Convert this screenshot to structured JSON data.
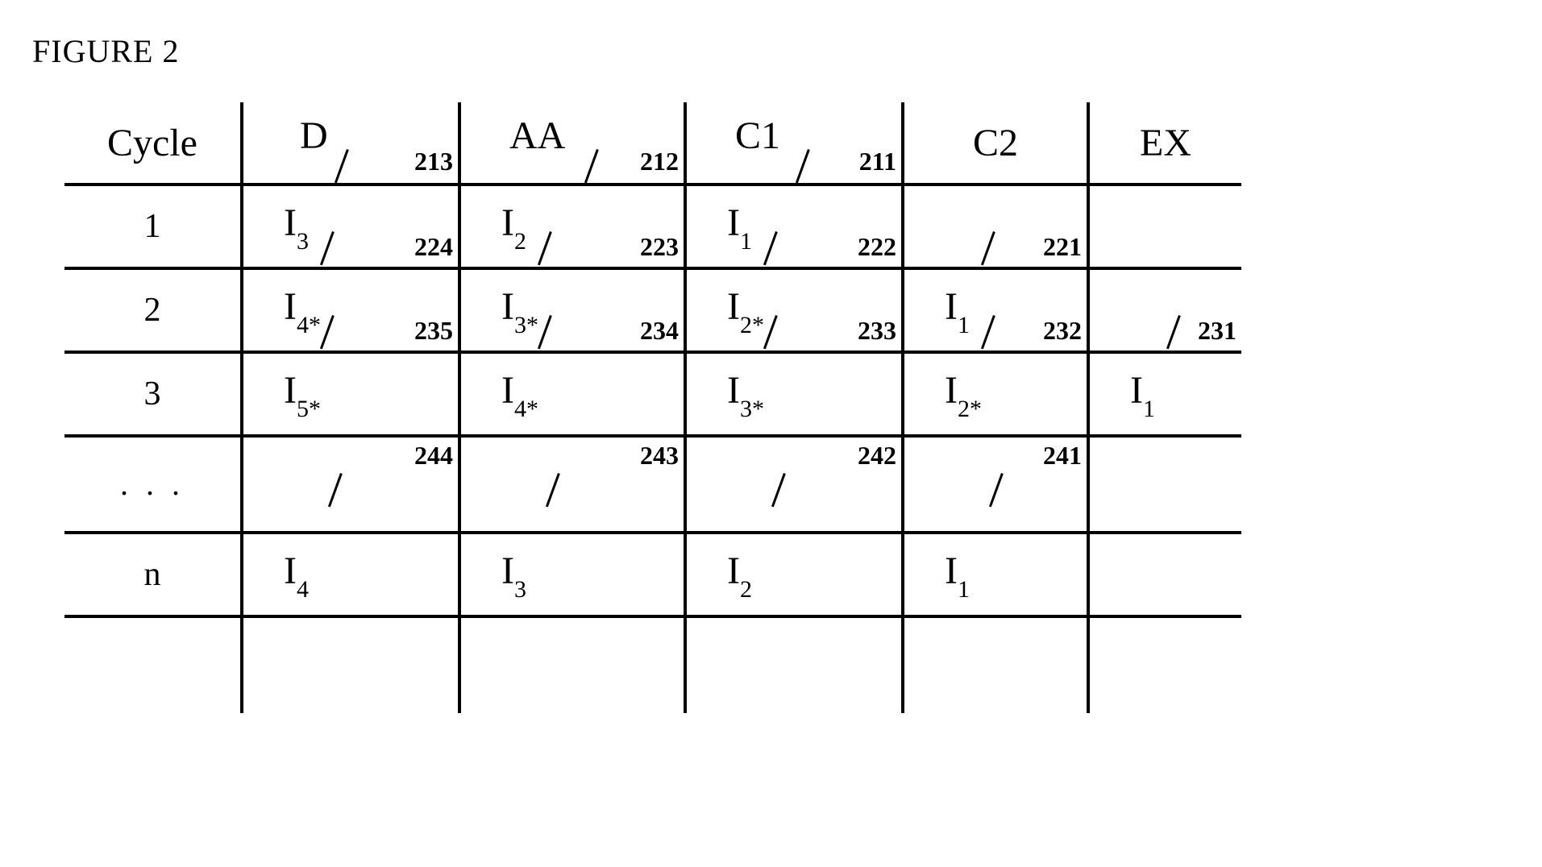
{
  "title": "FIGURE 2",
  "headers": {
    "cycle": "Cycle",
    "d": {
      "label": "D",
      "ref": "213",
      "has_slash": true
    },
    "aa": {
      "label": "AA",
      "ref": "212",
      "has_slash": true
    },
    "c1": {
      "label": "C1",
      "ref": "211",
      "has_slash": true
    },
    "c2": {
      "label": "C2"
    },
    "ex": {
      "label": "EX"
    }
  },
  "rows": [
    {
      "cycle": "1",
      "d": {
        "base": "I",
        "sub": "3",
        "ref": "224",
        "slash": true
      },
      "aa": {
        "base": "I",
        "sub": "2",
        "ref": "223",
        "slash": true
      },
      "c1": {
        "base": "I",
        "sub": "1",
        "ref": "222",
        "slash": true
      },
      "c2": {
        "base": "",
        "sub": "",
        "ref": "221",
        "slash": true
      },
      "ex": {
        "base": "",
        "sub": ""
      }
    },
    {
      "cycle": "2",
      "d": {
        "base": "I",
        "sub": "4*",
        "ref": "235",
        "slash": true
      },
      "aa": {
        "base": "I",
        "sub": "3*",
        "ref": "234",
        "slash": true
      },
      "c1": {
        "base": "I",
        "sub": "2*",
        "ref": "233",
        "slash": true
      },
      "c2": {
        "base": "I",
        "sub": "1",
        "ref": "232",
        "slash": true
      },
      "ex": {
        "base": "",
        "sub": "",
        "ref": "231",
        "slash": true
      }
    },
    {
      "cycle": "3",
      "d": {
        "base": "I",
        "sub": "5*"
      },
      "aa": {
        "base": "I",
        "sub": "4*"
      },
      "c1": {
        "base": "I",
        "sub": "3*"
      },
      "c2": {
        "base": "I",
        "sub": "2*"
      },
      "ex": {
        "base": "I",
        "sub": "1"
      }
    },
    {
      "cycle": ". . .",
      "d": {
        "base": "",
        "sub": "",
        "ref": "244",
        "slash": true,
        "ref_pos": "tr"
      },
      "aa": {
        "base": "",
        "sub": "",
        "ref": "243",
        "slash": true,
        "ref_pos": "tr"
      },
      "c1": {
        "base": "",
        "sub": "",
        "ref": "242",
        "slash": true,
        "ref_pos": "tr"
      },
      "c2": {
        "base": "",
        "sub": "",
        "ref": "241",
        "slash": true,
        "ref_pos": "tr"
      },
      "ex": {
        "base": "",
        "sub": ""
      }
    },
    {
      "cycle": "n",
      "d": {
        "base": "I",
        "sub": "4"
      },
      "aa": {
        "base": "I",
        "sub": "3"
      },
      "c1": {
        "base": "I",
        "sub": "2"
      },
      "c2": {
        "base": "I",
        "sub": "1"
      },
      "ex": {
        "base": "",
        "sub": ""
      }
    }
  ],
  "chart_data": {
    "type": "table",
    "title": "FIGURE 2 — Pipeline stage occupancy per cycle",
    "columns": [
      "Cycle",
      "D",
      "AA",
      "C1",
      "C2",
      "EX"
    ],
    "column_refs": {
      "D": 213,
      "AA": 212,
      "C1": 211
    },
    "rows": [
      {
        "Cycle": "1",
        "D": "I3",
        "AA": "I2",
        "C1": "I1",
        "C2": "",
        "EX": ""
      },
      {
        "Cycle": "2",
        "D": "I4*",
        "AA": "I3*",
        "C1": "I2*",
        "C2": "I1",
        "EX": ""
      },
      {
        "Cycle": "3",
        "D": "I5*",
        "AA": "I4*",
        "C1": "I3*",
        "C2": "I2*",
        "EX": "I1"
      },
      {
        "Cycle": "...",
        "D": "",
        "AA": "",
        "C1": "",
        "C2": "",
        "EX": ""
      },
      {
        "Cycle": "n",
        "D": "I4",
        "AA": "I3",
        "C1": "I2",
        "C2": "I1",
        "EX": ""
      }
    ],
    "cell_refs": {
      "1": {
        "D": 224,
        "AA": 223,
        "C1": 222,
        "C2": 221
      },
      "2": {
        "D": 235,
        "AA": 234,
        "C1": 233,
        "C2": 232,
        "EX": 231
      },
      "...": {
        "D": 244,
        "AA": 243,
        "C1": 242,
        "C2": 241
      }
    }
  }
}
